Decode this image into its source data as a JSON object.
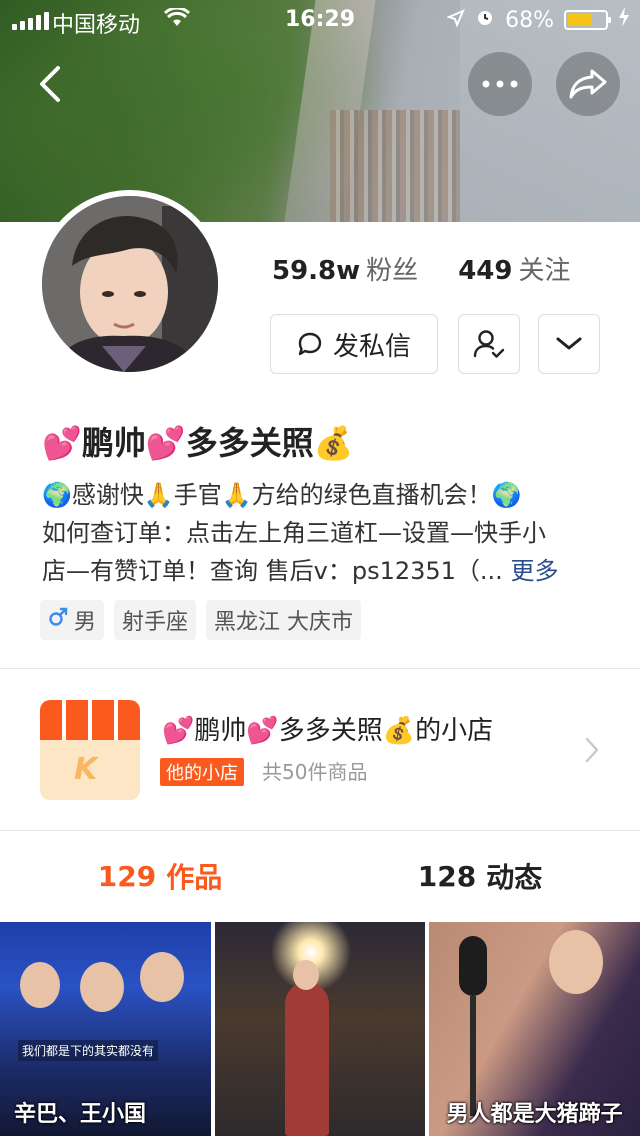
{
  "status_bar": {
    "carrier": "中国移动",
    "time": "16:29",
    "battery_percent": "68%",
    "battery_level": 0.68
  },
  "profile": {
    "followers_count": "59.8w",
    "followers_label": "粉丝",
    "following_count": "449",
    "following_label": "关注",
    "message_button": "发私信",
    "name": "💕鹏帅💕多多关照💰",
    "bio_lines": [
      "🌍感谢快🙏手官🙏方给的绿色直播机会！🌍",
      "如何查订单：点击左上角三道杠—设置—快手小",
      "店—有赞订单！查询 售后v：ps12351（..."
    ],
    "bio_more": "更多",
    "tags": {
      "gender": "男",
      "zodiac": "射手座",
      "location": "黑龙江 大庆市"
    }
  },
  "shop": {
    "title": "💕鹏帅💕多多关照💰的小店",
    "badge": "他的小店",
    "count": "共50件商品"
  },
  "tabs": [
    {
      "count": "129",
      "label": "作品"
    },
    {
      "count": "128",
      "label": "动态"
    }
  ],
  "thumbnails": [
    {
      "caption": "辛巴、王小国",
      "subtitle": "我们都是下的其实都没有"
    },
    {
      "caption": ""
    },
    {
      "caption": "男人都是大猪蹄子"
    }
  ],
  "colors": {
    "accent": "#fa5a1e",
    "link": "#2b4d8c",
    "battery": "#f5c518"
  }
}
